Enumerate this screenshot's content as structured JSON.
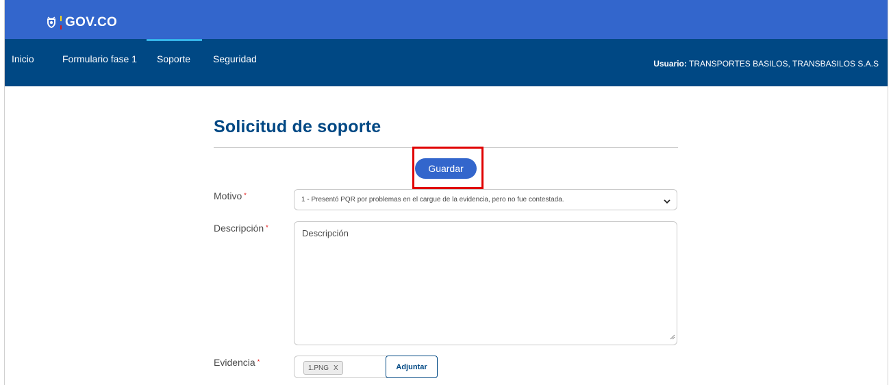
{
  "header": {
    "logo_text": "GOV.CO",
    "logo_icon": "escudo-icon"
  },
  "nav": {
    "items": [
      {
        "label": "Inicio",
        "active": false
      },
      {
        "label": "Formulario fase 1",
        "active": false
      },
      {
        "label": "Soporte",
        "active": true
      },
      {
        "label": "Seguridad",
        "active": false
      }
    ],
    "user_label": "Usuario:",
    "user_value": "TRANSPORTES BASILOS, TRANSBASILOS S.A.S"
  },
  "form": {
    "title": "Solicitud de soporte",
    "save_label": "Guardar",
    "required_mark": "*",
    "motivo_label": "Motivo",
    "motivo_value": "1 - Presentó PQR por problemas en el cargue de la evidencia, pero no fue contestada.",
    "descripcion_label": "Descripción",
    "descripcion_placeholder": "Descripción",
    "evidencia_label": "Evidencia",
    "evidencia_file": "1.PNG",
    "evidencia_remove": "X",
    "attach_label": "Adjuntar"
  },
  "colors": {
    "topbar": "#3366cc",
    "navbar": "#004884",
    "accent": "#3366cc",
    "title": "#004884",
    "highlight": "#e00000"
  }
}
